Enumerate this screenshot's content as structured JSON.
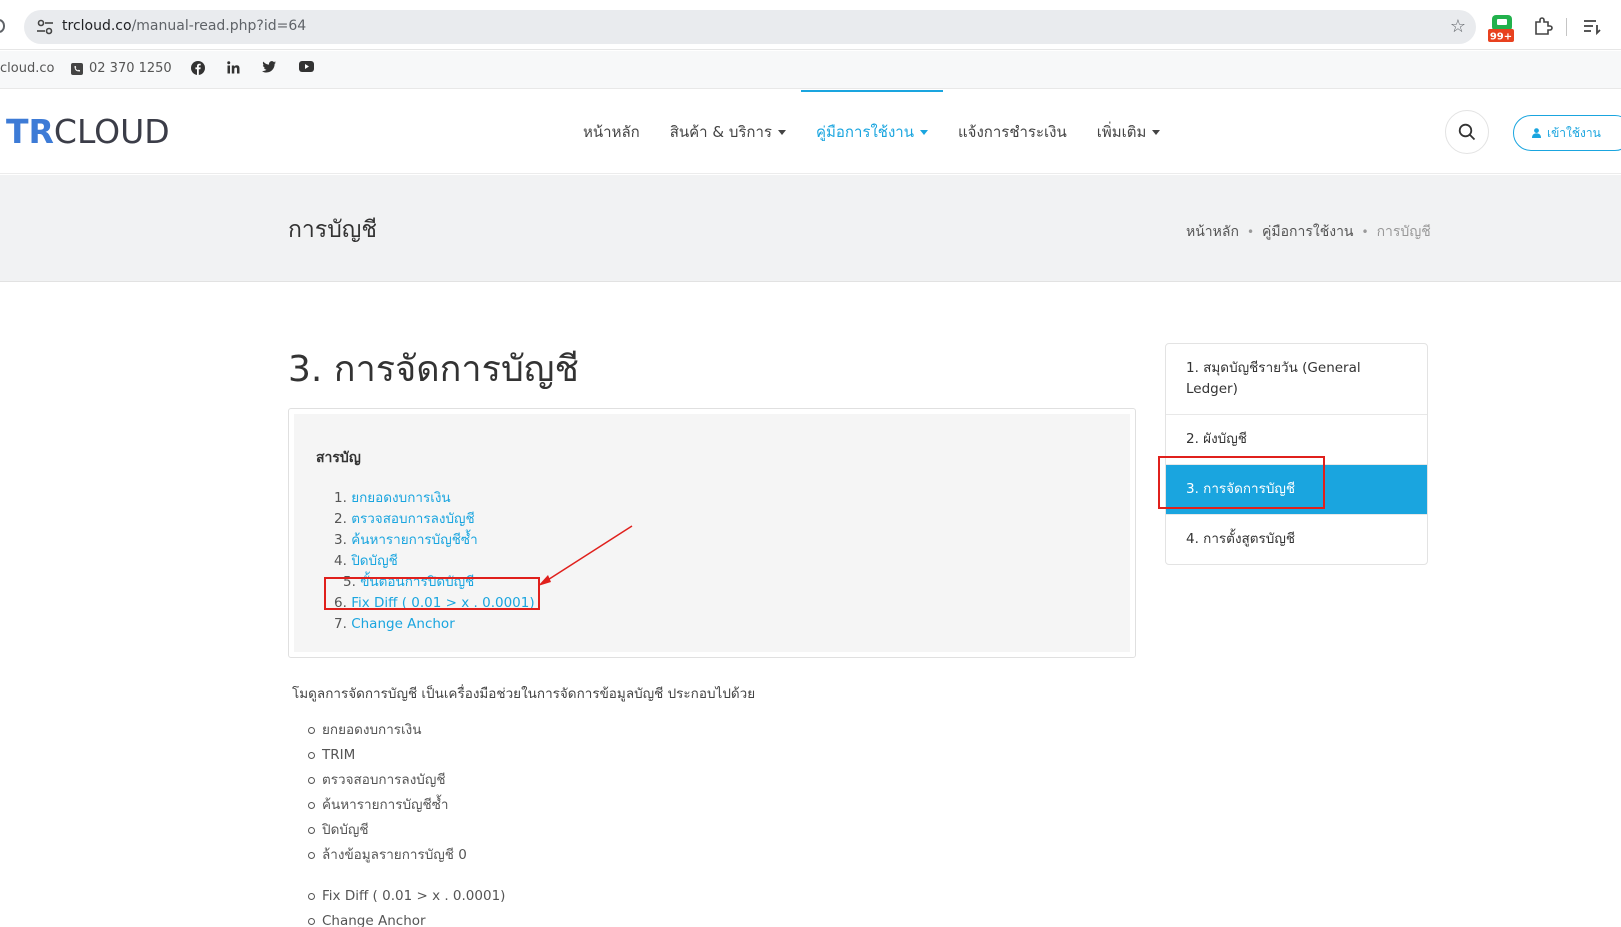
{
  "browser": {
    "url_host": "trcloud.co",
    "url_path": "/manual-read.php?id=64",
    "extension_badge": "99+"
  },
  "topbar": {
    "email_fragment": "cloud.co",
    "phone": "02 370 1250"
  },
  "header": {
    "logo_part1": "TR",
    "logo_part2": "CLOUD",
    "nav": [
      {
        "label": "หน้าหลัก",
        "dropdown": false,
        "active": false
      },
      {
        "label": "สินค้า & บริการ",
        "dropdown": true,
        "active": false
      },
      {
        "label": "คู่มือการใช้งาน",
        "dropdown": true,
        "active": true
      },
      {
        "label": "แจ้งการชำระเงิน",
        "dropdown": false,
        "active": false
      },
      {
        "label": "เพิ่มเติม",
        "dropdown": true,
        "active": false
      }
    ],
    "login_label": "เข้าใช้งาน"
  },
  "title_bar": {
    "title": "การบัญชี",
    "breadcrumb": [
      "หน้าหลัก",
      "คู่มือการใช้งาน",
      "การบัญชี"
    ]
  },
  "main": {
    "heading": "3. การจัดการบัญชี",
    "toc_title": "สารบัญ",
    "toc": [
      {
        "num": "1.",
        "label": "ยกยอดงบการเงิน"
      },
      {
        "num": "2.",
        "label": "ตรวจสอบการลงบัญชี"
      },
      {
        "num": "3.",
        "label": "ค้นหารายการบัญชีซ้ำ"
      },
      {
        "num": "4.",
        "label": "ปิดบัญชี"
      },
      {
        "num": "5.",
        "label": "ขั้นตอนการปิดบัญชี"
      },
      {
        "num": "6.",
        "label": "Fix Diff ( 0.01 > x . 0.0001)"
      },
      {
        "num": "7.",
        "label": "Change Anchor"
      }
    ],
    "intro": "โมดูลการจัดการบัญชี เป็นเครื่องมือช่วยในการจัดการข้อมูลบัญชี ประกอบไปด้วย",
    "bullets": [
      "ยกยอดงบการเงิน",
      "TRIM",
      "ตรวจสอบการลงบัญชี",
      "ค้นหารายการบัญชีซ้ำ",
      "ปิดบัญชี",
      "ล้างข้อมูลรายการบัญชี 0",
      "Fix Diff ( 0.01 > x . 0.0001)",
      "Change Anchor"
    ]
  },
  "side_nav": [
    {
      "label": "1. สมุดบัญชีรายวัน (General Ledger)",
      "active": false
    },
    {
      "label": "2. ผังบัญชี",
      "active": false
    },
    {
      "label": "3. การจัดการบัญชี",
      "active": true
    },
    {
      "label": "4. การตั้งสูตรบัญชี",
      "active": false
    }
  ],
  "colors": {
    "accent": "#1aa5df",
    "highlight_annotation": "#e0201c"
  }
}
